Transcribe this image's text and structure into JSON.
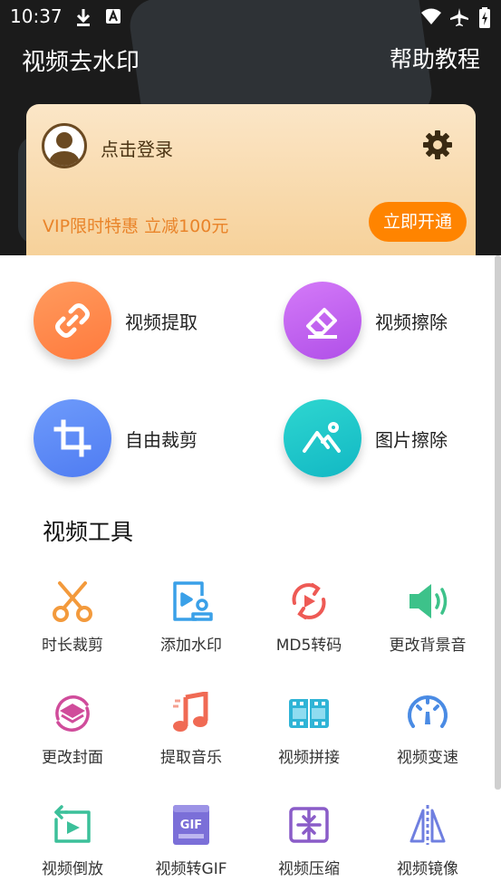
{
  "status_bar": {
    "time": "10:37",
    "left_icons": [
      "download-icon",
      "a-icon"
    ],
    "right_icons": [
      "wifi-icon",
      "airplane-icon",
      "battery-charging-icon"
    ]
  },
  "header": {
    "title": "视频去水印",
    "help_label": "帮助教程"
  },
  "vip_card": {
    "login_label": "点击登录",
    "settings_icon": "gear-icon",
    "promo_text": "VIP限时特惠 立减100元",
    "open_button": "立即开通",
    "accent_color": "#ff8400"
  },
  "features": [
    {
      "label": "视频提取",
      "icon": "link-icon",
      "color": "#ff8a4c"
    },
    {
      "label": "视频擦除",
      "icon": "eraser-icon",
      "color": "#c25cf0"
    },
    {
      "label": "自由裁剪",
      "icon": "crop-icon",
      "color": "#5b88f6"
    },
    {
      "label": "图片擦除",
      "icon": "image-mountain-icon",
      "color": "#19c4c8"
    }
  ],
  "tools_section": {
    "title": "视频工具",
    "items": [
      {
        "label": "时长裁剪",
        "icon": "scissors-icon"
      },
      {
        "label": "添加水印",
        "icon": "watermark-icon"
      },
      {
        "label": "MD5转码",
        "icon": "md5-convert-icon"
      },
      {
        "label": "更改背景音",
        "icon": "speaker-icon"
      },
      {
        "label": "更改封面",
        "icon": "cover-icon"
      },
      {
        "label": "提取音乐",
        "icon": "music-note-icon"
      },
      {
        "label": "视频拼接",
        "icon": "film-join-icon"
      },
      {
        "label": "视频变速",
        "icon": "speedometer-icon"
      },
      {
        "label": "视频倒放",
        "icon": "reverse-play-icon"
      },
      {
        "label": "视频转GIF",
        "icon": "gif-icon"
      },
      {
        "label": "视频压缩",
        "icon": "compress-icon"
      },
      {
        "label": "视频镜像",
        "icon": "mirror-icon"
      }
    ]
  }
}
